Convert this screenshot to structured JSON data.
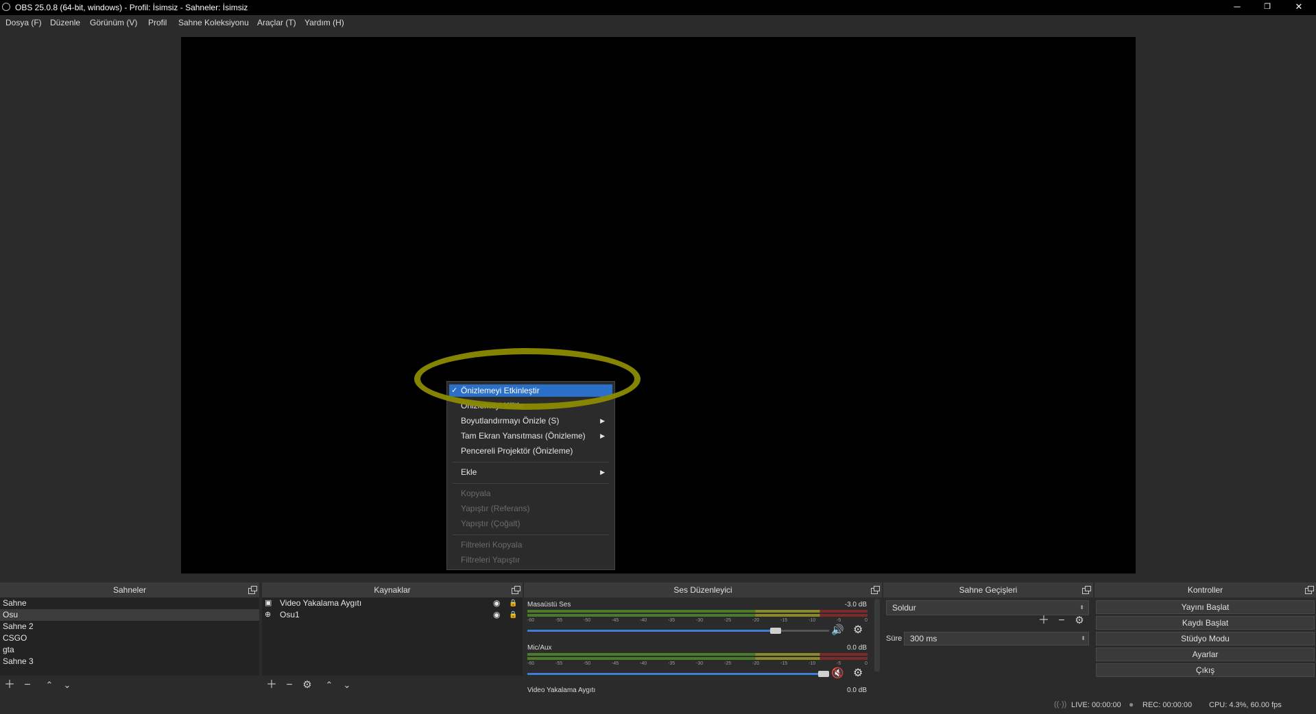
{
  "window": {
    "title": "OBS 25.0.8 (64-bit, windows) - Profil: İsimsiz - Sahneler: İsimsiz",
    "minimize": "─",
    "restore": "❐",
    "close": "✕"
  },
  "menu": [
    "Dosya (F)",
    "Düzenle",
    "Görünüm (V)",
    "Profil",
    "Sahne Koleksiyonu",
    "Araçlar (T)",
    "Yardım (H)"
  ],
  "context_menu": {
    "items": [
      {
        "label": "Önizlemeyi Etkinleştir",
        "checked": true,
        "selected": true
      },
      {
        "label": "Önizlemeyi Kilitle"
      },
      {
        "label": "Boyutlandırmayı Önizle (S)",
        "submenu": true
      },
      {
        "label": "Tam Ekran Yansıtması (Önizleme)",
        "submenu": true
      },
      {
        "label": "Pencereli Projektör (Önizleme)"
      },
      {
        "label": "Ekle",
        "submenu": true
      },
      {
        "label": "Kopyala",
        "disabled": true
      },
      {
        "label": "Yapıştır (Referans)",
        "disabled": true
      },
      {
        "label": "Yapıştır (Çoğalt)",
        "disabled": true
      },
      {
        "label": "Filtreleri Kopyala",
        "disabled": true
      },
      {
        "label": "Filtreleri Yapıştır",
        "disabled": true
      }
    ],
    "highlight_color": "#8b8b00"
  },
  "scenes": {
    "title": "Sahneler",
    "items": [
      "Sahne",
      "Osu",
      "Sahne 2",
      "CSGO",
      "gta",
      "Sahne 3"
    ],
    "selected": "Osu"
  },
  "sources": {
    "title": "Kaynaklar",
    "items": [
      {
        "label": "Video Yakalama Aygıtı",
        "icon": "camera-icon"
      },
      {
        "label": "Osu1",
        "icon": "gamepad-icon"
      }
    ]
  },
  "mixer": {
    "title": "Ses Düzenleyici",
    "channels": [
      {
        "name": "Masaüstü Ses",
        "db": "-3.0 dB",
        "volume": 0.84,
        "muted": false
      },
      {
        "name": "Mic/Aux",
        "db": "0.0 dB",
        "volume": 1.0,
        "muted": true
      },
      {
        "name": "Video Yakalama Aygıtı",
        "db": "0.0 dB"
      }
    ],
    "ticks": [
      "-60",
      "-55",
      "-50",
      "-45",
      "-40",
      "-35",
      "-30",
      "-25",
      "-20",
      "-15",
      "-10",
      "-5",
      "0"
    ]
  },
  "transitions": {
    "title": "Sahne Geçişleri",
    "current": "Soldur",
    "duration_label": "Süre",
    "duration_value": "300 ms"
  },
  "controls": {
    "title": "Kontroller",
    "buttons": [
      "Yayını Başlat",
      "Kaydı Başlat",
      "Stüdyo Modu",
      "Ayarlar",
      "Çıkış"
    ]
  },
  "status": {
    "live": "LIVE: 00:00:00",
    "rec": "REC: 00:00:00",
    "cpu": "CPU: 4.3%, 60.00 fps"
  }
}
